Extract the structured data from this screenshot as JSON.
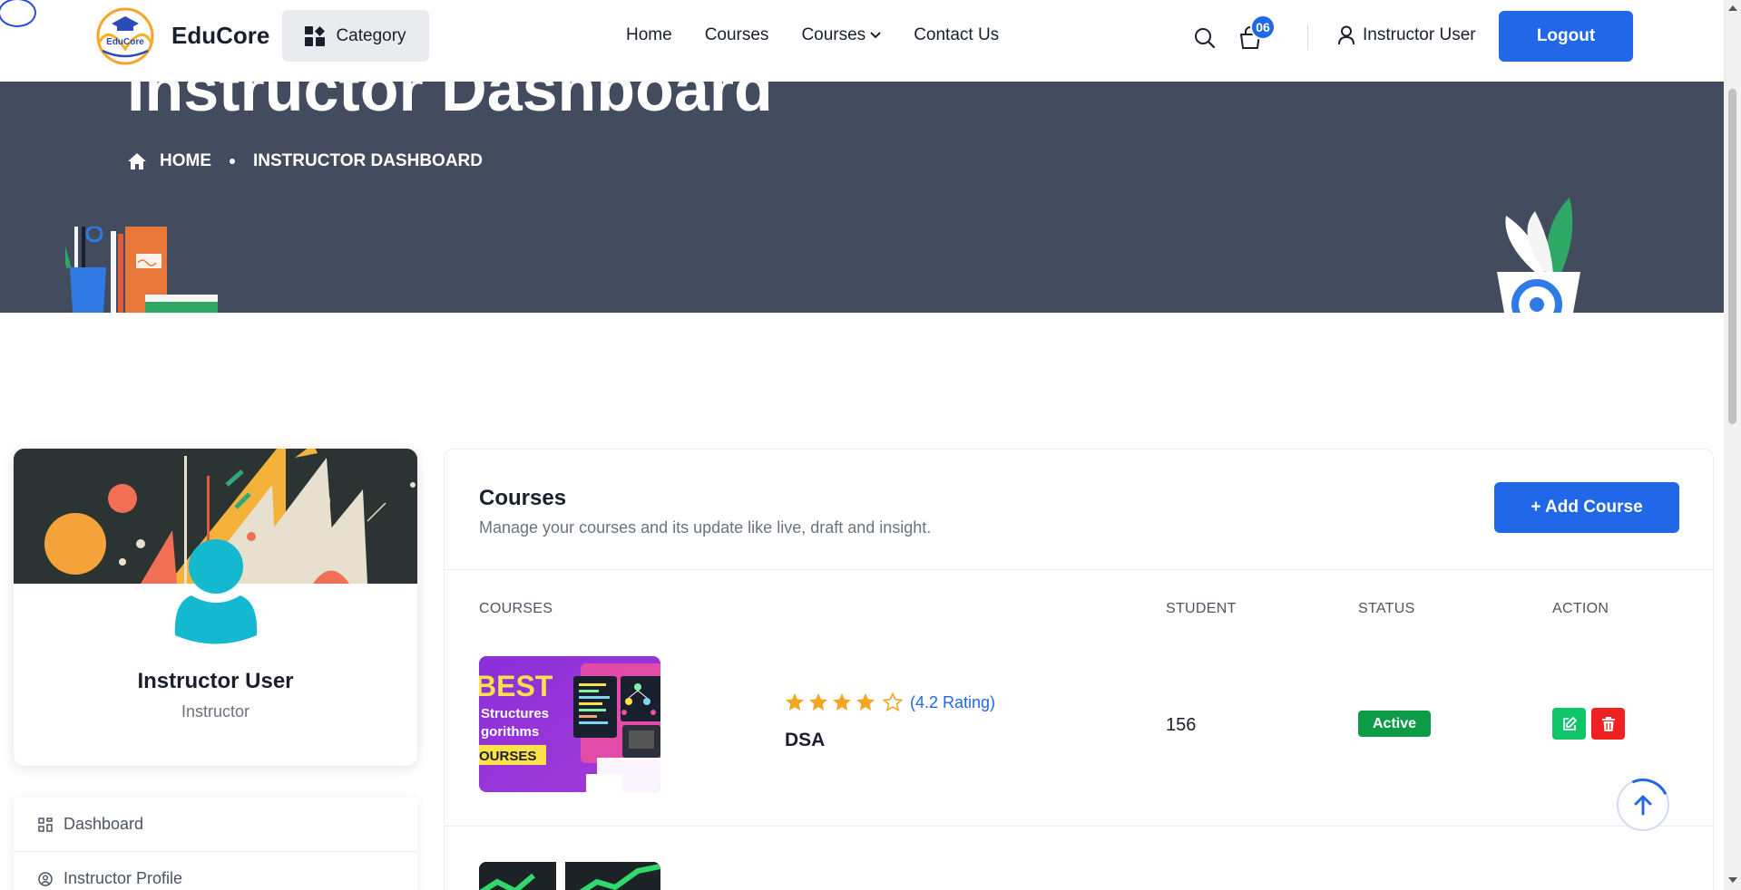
{
  "header": {
    "logo_text": "EduCore",
    "logo_badge_text": "EduCore",
    "category_label": "Category",
    "nav": [
      {
        "label": "Home"
      },
      {
        "label": "Courses"
      },
      {
        "label": "Courses",
        "has_dropdown": true
      },
      {
        "label": "Contact Us"
      }
    ],
    "cart_count": "06",
    "user_label": "Instructor User",
    "logout_label": "Logout"
  },
  "hero": {
    "title": "Instructor Dashboard",
    "breadcrumb_home": "HOME",
    "breadcrumb_current": "INSTRUCTOR DASHBOARD"
  },
  "profile": {
    "name": "Instructor User",
    "role": "Instructor"
  },
  "sidebar": {
    "items": [
      {
        "label": "Dashboard",
        "icon": "grid-icon"
      },
      {
        "label": "Instructor Profile",
        "icon": "user-circle-icon"
      }
    ]
  },
  "courses_panel": {
    "title": "Courses",
    "subtitle": "Manage your courses and its update like live, draft and insight.",
    "add_button": "+ Add Course",
    "columns": [
      "COURSES",
      "STUDENT",
      "STATUS",
      "ACTION"
    ],
    "rows": [
      {
        "thumbnail_text_1": "BEST",
        "thumbnail_text_2": "Structures",
        "thumbnail_text_3": "gorithms",
        "thumbnail_text_4": "OURSES",
        "rating": 4.2,
        "rating_text": "(4.2 Rating)",
        "name": "DSA",
        "students": "156",
        "status": "Active"
      }
    ]
  },
  "colors": {
    "primary": "#2168e8",
    "hero_bg": "#434b5e",
    "status_active": "#0d9b48",
    "edit": "#10c469",
    "delete": "#ef2121",
    "star": "#f5a524"
  }
}
